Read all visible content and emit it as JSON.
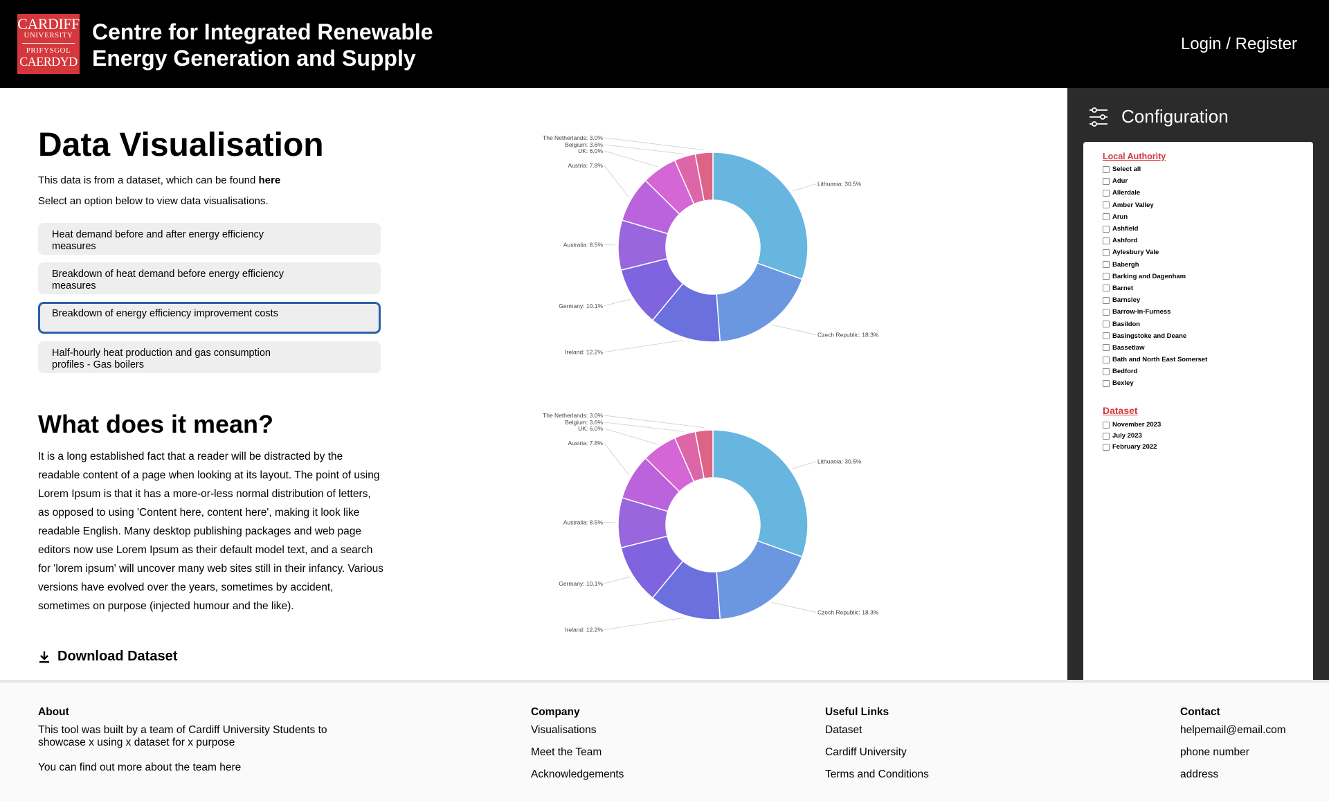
{
  "header": {
    "logo": {
      "line1": "CARDIFF",
      "line2": "UNIVERSITY",
      "line3": "PRIFYSGOL",
      "line4": "CAERDYD"
    },
    "title": "Centre for Integrated Renewable Energy Generation and Supply",
    "login": "Login / Register"
  },
  "main": {
    "title": "Data Visualisation",
    "intro_prefix": "This data is from a dataset, which can be found ",
    "intro_link": "here",
    "instruction": "Select an option below to view data visualisations.",
    "options": [
      "Heat demand before and after energy efficiency measures",
      "Breakdown of heat demand before energy efficiency measures",
      "Breakdown of energy efficiency improvement costs",
      "Half-hourly heat production and gas consumption profiles - Gas boilers"
    ],
    "selected_option": 2,
    "meaning_title": "What does it mean?",
    "meaning_text": "It is a long established fact that a reader will be distracted by the readable content of a page when looking at its layout. The point of using Lorem Ipsum is that it has a more-or-less normal distribution of letters, as opposed to using 'Content here, content here', making it look like readable English. Many desktop publishing packages and web page editors now use Lorem Ipsum as their default model text, and a search for 'lorem ipsum' will uncover many web sites still in their infancy. Various versions have evolved over the years, sometimes by accident, sometimes on purpose (injected humour and the like).",
    "download": "Download Dataset"
  },
  "chart_data": [
    {
      "type": "pie",
      "categories": [
        "Lithuania",
        "Czech Republic",
        "Ireland",
        "Germany",
        "Australia",
        "Austria",
        "UK",
        "Belgium",
        "The Netherlands"
      ],
      "values": [
        30.5,
        18.3,
        12.2,
        10.1,
        8.5,
        7.8,
        6.0,
        3.6,
        3.0
      ],
      "labels": [
        "Lithuania: 30.5%",
        "Czech Republic: 18.3%",
        "Ireland: 12.2%",
        "Germany: 10.1%",
        "Australia: 8.5%",
        "Austria: 7.8%",
        "UK: 6.0%",
        "Belgium: 3.6%",
        "The Netherlands: 3.0%"
      ],
      "colors": [
        "#67b6df",
        "#6b97e0",
        "#6b70df",
        "#7f63df",
        "#9966dd",
        "#bb63dd",
        "#d466d6",
        "#dd66a9",
        "#de6487"
      ]
    },
    {
      "type": "pie",
      "categories": [
        "Lithuania",
        "Czech Republic",
        "Ireland",
        "Germany",
        "Australia",
        "Austria",
        "UK",
        "Belgium",
        "The Netherlands"
      ],
      "values": [
        30.5,
        18.3,
        12.2,
        10.1,
        8.5,
        7.8,
        6.0,
        3.6,
        3.0
      ],
      "labels": [
        "Lithuania: 30.5%",
        "Czech Republic: 18.3%",
        "Ireland: 12.2%",
        "Germany: 10.1%",
        "Australia: 8.5%",
        "Austria: 7.8%",
        "UK: 6.0%",
        "Belgium: 3.6%",
        "The Netherlands: 3.0%"
      ],
      "colors": [
        "#67b6df",
        "#6b97e0",
        "#6b70df",
        "#7f63df",
        "#9966dd",
        "#bb63dd",
        "#d466d6",
        "#dd66a9",
        "#de6487"
      ]
    }
  ],
  "config": {
    "title": "Configuration",
    "local_authority_title": "Local Authority",
    "local_authorities": [
      "Select all",
      "Adur",
      "Allerdale",
      "Amber Valley",
      "Arun",
      "Ashfield",
      "Ashford",
      "Aylesbury Vale",
      "Babergh",
      "Barking and Dagenham",
      "Barnet",
      "Barnsley",
      "Barrow-in-Furness",
      "Basildon",
      "Basingstoke and Deane",
      "Bassetlaw",
      "Bath and North East Somerset",
      "Bedford",
      "Bexley"
    ],
    "dataset_title": "Dataset",
    "datasets": [
      "November 2023",
      "July 2023",
      "February 2022"
    ]
  },
  "footer": {
    "about": {
      "heading": "About",
      "text": "This tool was built by a team of Cardiff University Students to showcase x using x dataset for x purpose",
      "more": "You can find out more about the team here"
    },
    "company": {
      "heading": "Company",
      "links": [
        "Visualisations",
        "Meet the Team",
        "Acknowledgements"
      ]
    },
    "useful": {
      "heading": "Useful Links",
      "links": [
        "Dataset",
        "Cardiff University",
        "Terms and Conditions"
      ]
    },
    "contact": {
      "heading": "Contact",
      "items": [
        "helpemail@email.com",
        "phone number",
        "address"
      ]
    }
  }
}
